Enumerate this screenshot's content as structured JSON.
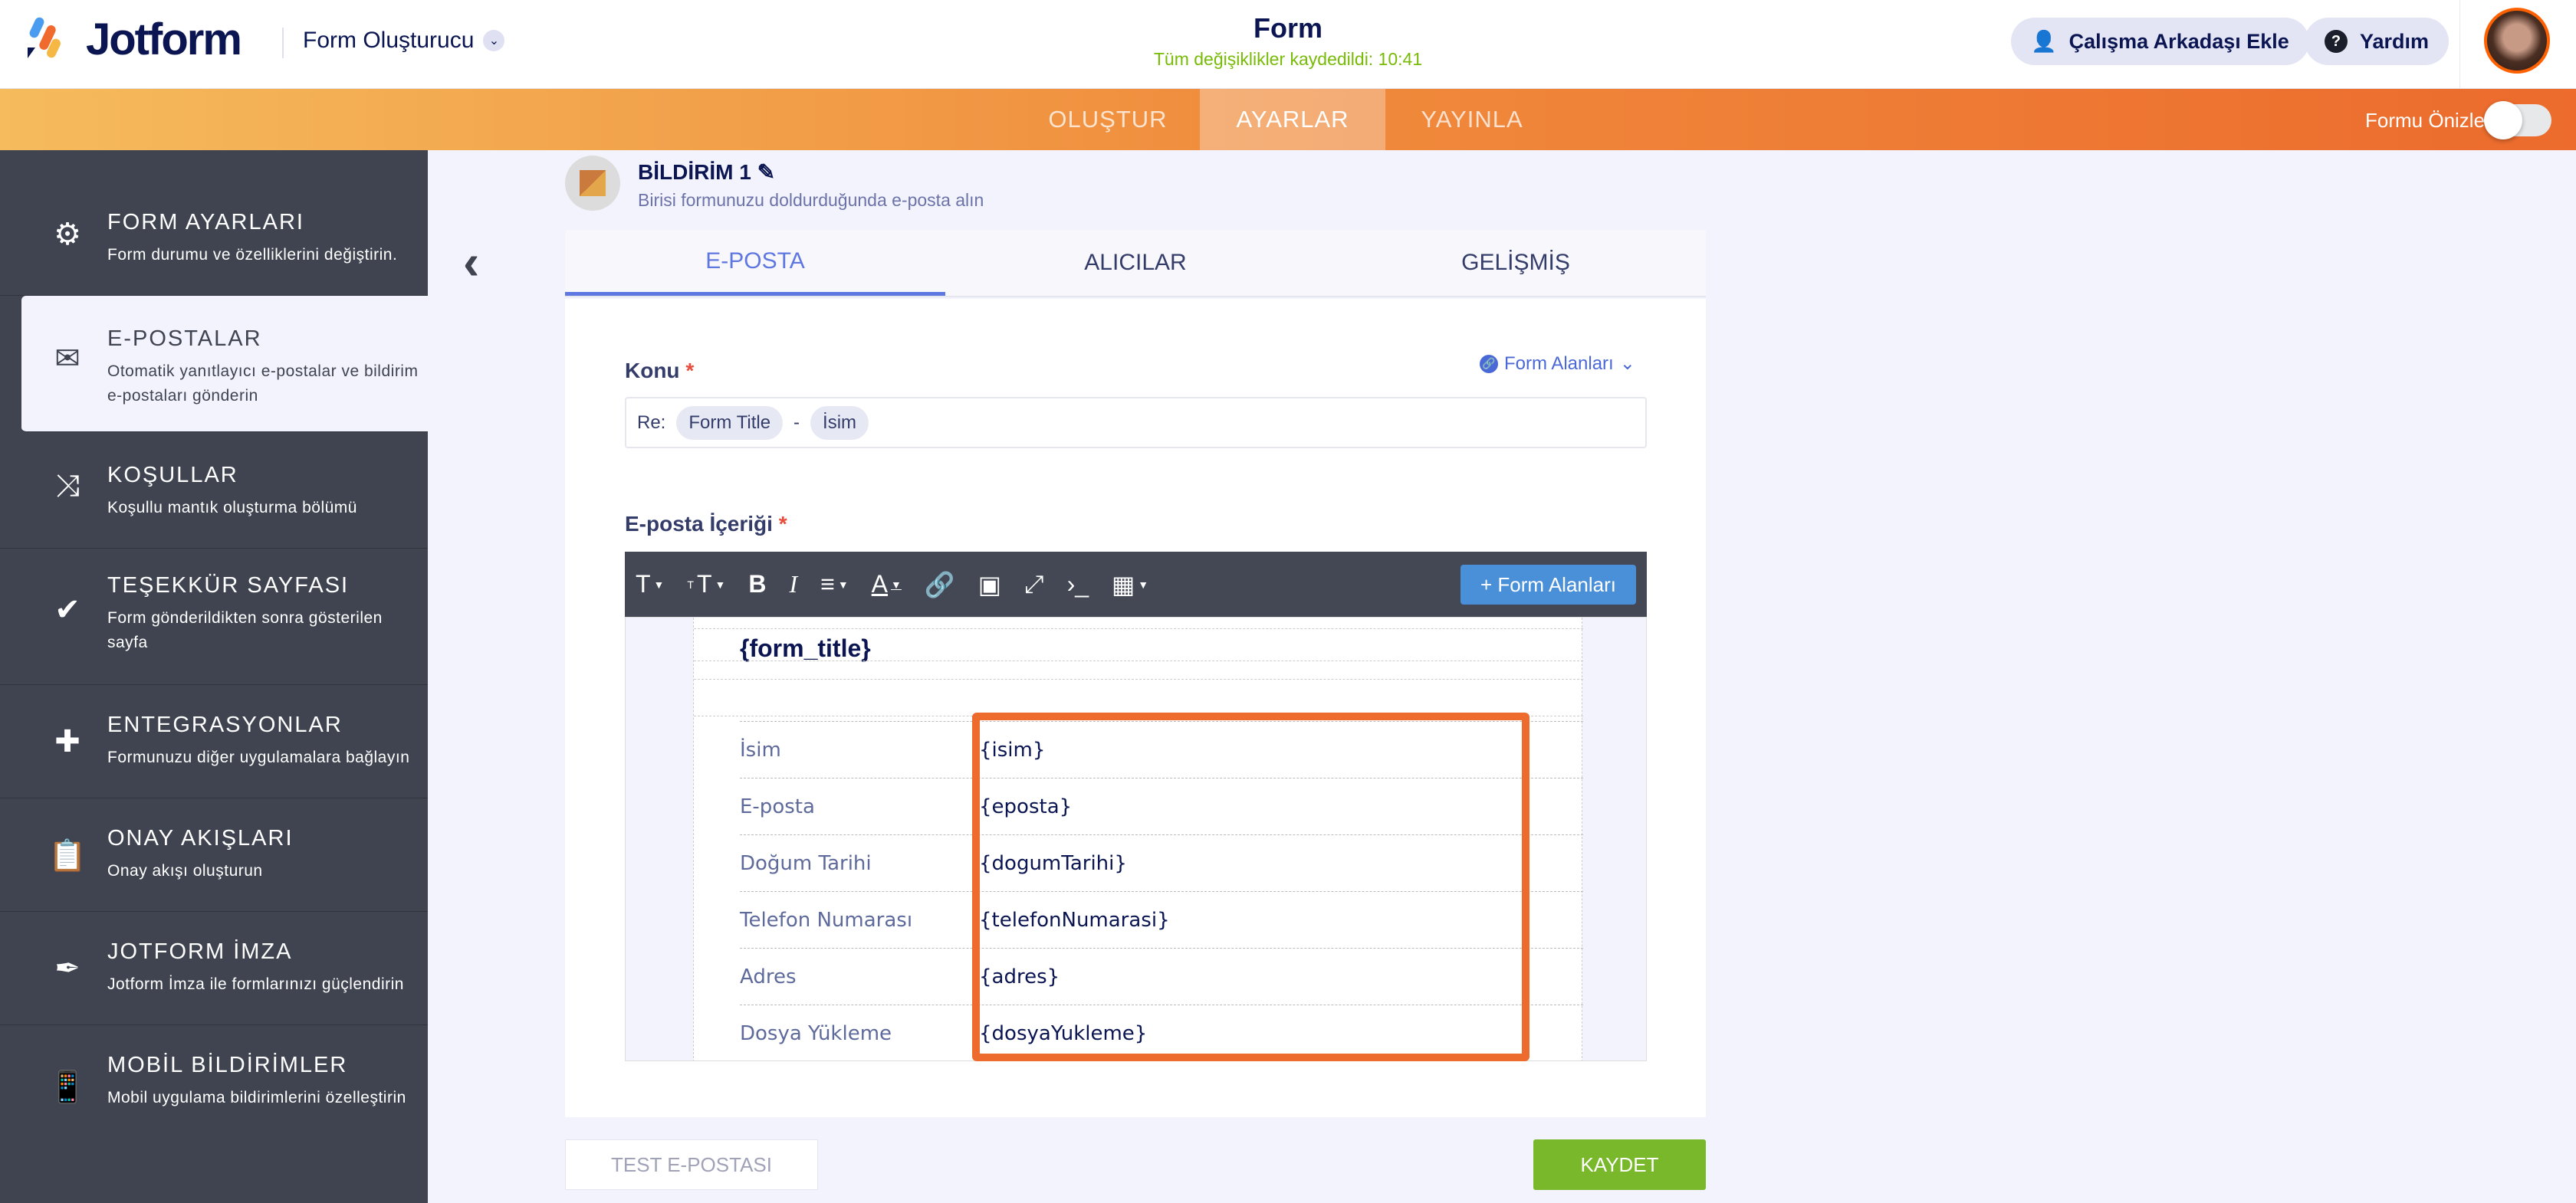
{
  "header": {
    "logo": "Jotform",
    "builder": "Form Oluşturucu",
    "title": "Form",
    "saved_status": "Tüm değişiklikler kaydedildi: 10:41",
    "invite": "Çalışma Arkadaşı Ekle",
    "help": "Yardım"
  },
  "nav": {
    "tabs": [
      "OLUŞTUR",
      "AYARLAR",
      "YAYINLA"
    ],
    "preview": "Formu Önizle"
  },
  "sidebar": [
    {
      "title": "FORM AYARLARI",
      "desc": "Form durumu ve özelliklerini değiştirin."
    },
    {
      "title": "E-POSTALAR",
      "desc": "Otomatik yanıtlayıcı e-postalar ve bildirim e-postaları gönderin"
    },
    {
      "title": "KOŞULLAR",
      "desc": "Koşullu mantık oluşturma bölümü"
    },
    {
      "title": "TEŞEKKÜR SAYFASI",
      "desc": "Form gönderildikten sonra gösterilen sayfa"
    },
    {
      "title": "ENTEGRASYONLAR",
      "desc": "Formunuzu diğer uygulamalara bağlayın"
    },
    {
      "title": "ONAY AKIŞLARI",
      "desc": "Onay akışı oluşturun"
    },
    {
      "title": "JOTFORM İMZA",
      "desc": "Jotform İmza ile formlarınızı güçlendirin"
    },
    {
      "title": "MOBİL BİLDİRİMLER",
      "desc": "Mobil uygulama bildirimlerini özelleştirin"
    }
  ],
  "notification": {
    "title": "BİLDİRİM 1",
    "desc": "Birisi formunuzu doldurduğunda e-posta alın"
  },
  "tabs": [
    "E-POSTA",
    "ALICILAR",
    "GELİŞMİŞ"
  ],
  "subject": {
    "label": "Konu",
    "required": "*",
    "prefix": "Re:",
    "tags": [
      "Form Title",
      "İsim"
    ],
    "sep": "-",
    "form_fields_link": "Form Alanları"
  },
  "content": {
    "label": "E-posta İçeriği",
    "required": "*",
    "add_field": "+ Form Alanları",
    "form_title": "{form_title}",
    "rows": [
      [
        "İsim",
        "{isim}"
      ],
      [
        "E-posta",
        "{eposta}"
      ],
      [
        "Doğum Tarihi",
        "{dogumTarihi}"
      ],
      [
        "Telefon Numarası",
        "{telefonNumarasi}"
      ],
      [
        "Adres",
        "{adres}"
      ],
      [
        "Dosya Yükleme",
        "{dosyaYukleme}"
      ]
    ]
  },
  "buttons": {
    "test": "TEST E-POSTASI",
    "save": "KAYDET"
  }
}
